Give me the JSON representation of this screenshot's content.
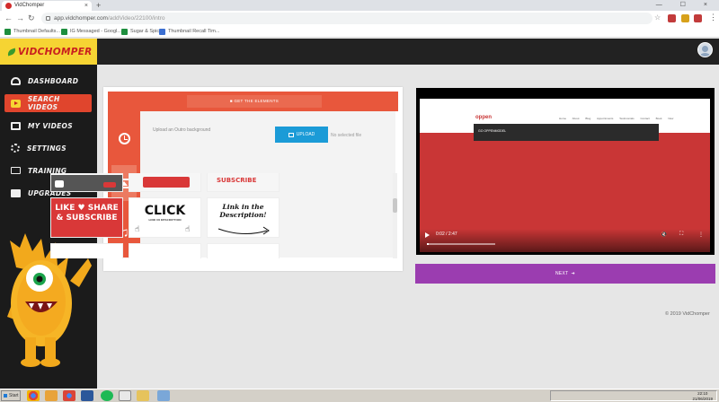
{
  "browser": {
    "tab_title": "VidChomper",
    "tab_close": "×",
    "new_tab": "+",
    "window_controls": "— ☐ ×",
    "url_host": "app.vidchomper.com",
    "url_path": "/addVideo/22100/intro",
    "bookmarks": [
      "Thumbnail Defaults...",
      "IG Messaged - Googl...",
      "Sugar & Spice",
      "Thumbnail Recall Tim..."
    ],
    "back": "←",
    "forward": "→",
    "reload": "↻",
    "bookmark_star": "☆",
    "menu": "⋮"
  },
  "app": {
    "logo": "VIDCHOMPER"
  },
  "sidebar": {
    "items": [
      {
        "label": "DASHBOARD",
        "icon": "dashboard-icon"
      },
      {
        "label": "SEARCH VIDEOS",
        "icon": "youtube-icon"
      },
      {
        "label": "MY VIDEOS",
        "icon": "video-icon"
      },
      {
        "label": "SETTINGS",
        "icon": "gear-icon"
      },
      {
        "label": "TRAINING",
        "icon": "monitor-icon"
      },
      {
        "label": "UPGRADES",
        "icon": "upgrade-icon"
      }
    ]
  },
  "editor": {
    "top_button": "■ GET THE ELEMENTS",
    "upload_label": "Upload an Outro background",
    "upload_button": "UPLOAD",
    "upload_status": "No selected file",
    "thumbnails": [
      {
        "text": "LIKE ♥ SHARE & SUBSCRIBE"
      },
      {
        "text": "CLICK",
        "subtext": "LINK IN DESCRIPTION"
      },
      {
        "text": "Link in the Description!"
      }
    ],
    "partial_thumbnail_text": "SUBSCRIBE"
  },
  "preview": {
    "site_logo": "oppen",
    "site_menu": "Home About Blog Appointments Testimonials Contact Book Now",
    "dropdown_text": "GO OPPENMODEL",
    "time": "0:02 / 2:47",
    "volume_icon": "🔇",
    "fullscreen_icon": "⛶",
    "more_icon": "⋮"
  },
  "actions": {
    "next_label": "NEXT",
    "next_arrow": "➜"
  },
  "footer": {
    "copyright": "© 2019 VidChomper"
  },
  "taskbar": {
    "start": "Start",
    "time": "22:10",
    "date": "21/06/2019"
  },
  "colors": {
    "accent_orange": "#e8573c",
    "logo_yellow": "#f6d433",
    "upload_blue": "#1b9bd7",
    "next_purple": "#9b3db0",
    "sidebar_dark": "#1b1b1b"
  }
}
